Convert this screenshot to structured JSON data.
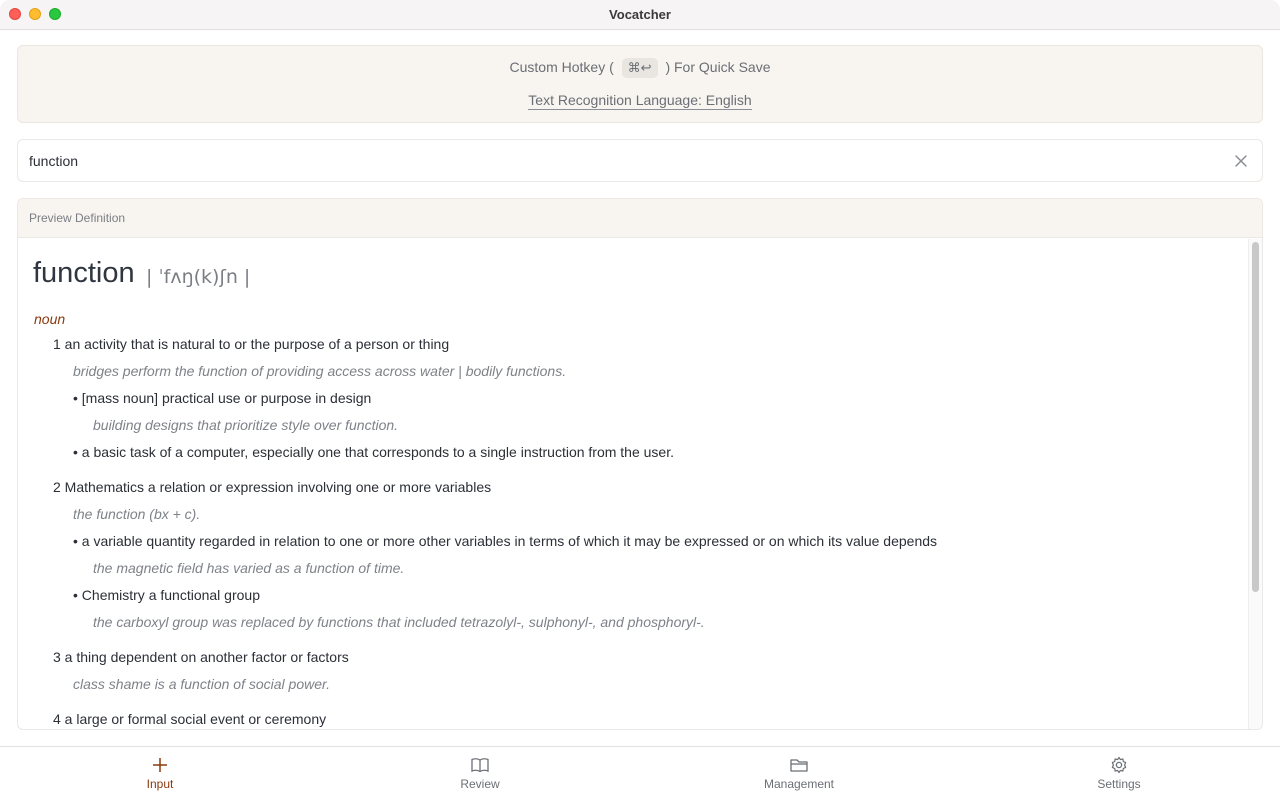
{
  "window": {
    "title": "Vocatcher"
  },
  "banner": {
    "hotkey_prefix": "Custom Hotkey (",
    "hotkey_key": "⌘↩",
    "hotkey_suffix": ") For Quick Save",
    "language_link": "Text Recognition Language: English"
  },
  "search": {
    "value": "function"
  },
  "preview": {
    "header": "Preview Definition",
    "headword": "function",
    "pronunciation": "| ˈfʌŋ(k)ʃn |",
    "part_of_speech": "noun",
    "lines": [
      {
        "kind": "sense",
        "text": "1 an activity that is natural to or the purpose of a person or thing"
      },
      {
        "kind": "example",
        "text": "bridges perform the function of providing access across water | bodily functions."
      },
      {
        "kind": "subsense",
        "text": "• [mass noun] practical use or purpose in design"
      },
      {
        "kind": "subexample",
        "text": "building designs that prioritize style over function."
      },
      {
        "kind": "subsense",
        "text": "• a basic task of a computer, especially one that corresponds to a single instruction from the user."
      },
      {
        "kind": "sense",
        "text": "2 Mathematics a relation or expression involving one or more variables"
      },
      {
        "kind": "example",
        "text": "the function (bx + c)."
      },
      {
        "kind": "subsense",
        "text": "• a variable quantity regarded in relation to one or more other variables in terms of which it may be expressed or on which its value depends"
      },
      {
        "kind": "subexample",
        "text": "the magnetic field has varied as a function of time."
      },
      {
        "kind": "subsense",
        "text": "• Chemistry a functional group"
      },
      {
        "kind": "subexample",
        "text": "the carboxyl group was replaced by functions that included tetrazolyl-, sulphonyl-, and phosphoryl-."
      },
      {
        "kind": "sense",
        "text": "3 a thing dependent on another factor or factors"
      },
      {
        "kind": "example",
        "text": "class shame is a function of social power."
      },
      {
        "kind": "sense",
        "text": "4 a large or formal social event or ceremony"
      }
    ]
  },
  "tabs": [
    {
      "label": "Input",
      "icon": "plus-icon",
      "active": true
    },
    {
      "label": "Review",
      "icon": "book-icon",
      "active": false
    },
    {
      "label": "Management",
      "icon": "folder-icon",
      "active": false
    },
    {
      "label": "Settings",
      "icon": "gear-icon",
      "active": false
    }
  ],
  "colors": {
    "accent": "#8b3a0e",
    "banner_bg": "#f8f4f0"
  }
}
